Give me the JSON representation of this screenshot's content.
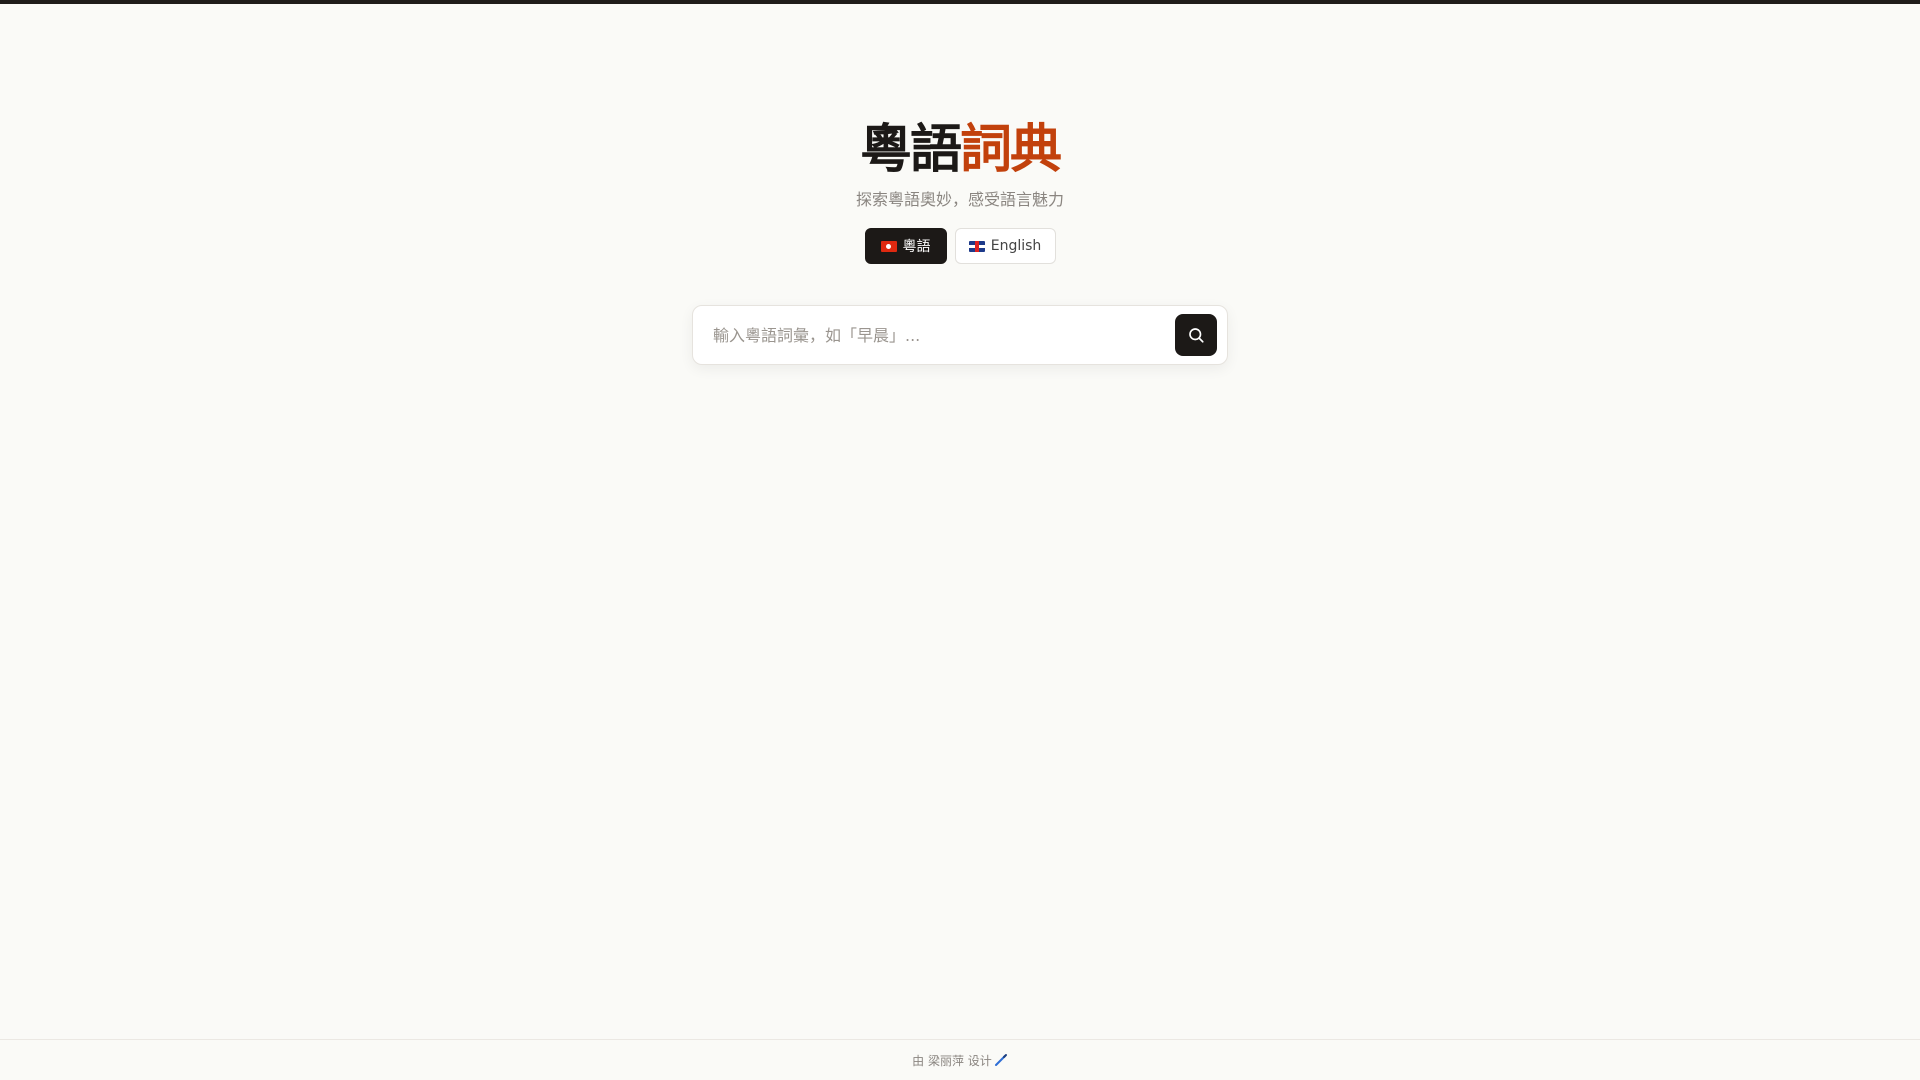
{
  "header": {
    "title_part1": "粵語",
    "title_part2": "詞典",
    "subtitle": "探索粵語奧妙，感受語言魅力"
  },
  "language_switch": {
    "options": [
      {
        "label": "粵語",
        "flag": "hong-kong-flag-icon",
        "active": true
      },
      {
        "label": "English",
        "flag": "uk-flag-icon",
        "active": false
      }
    ]
  },
  "search": {
    "placeholder": "輸入粵語詞彙，如「早晨」...",
    "value": "",
    "button_icon": "search-icon"
  },
  "footer": {
    "text": "由 梁丽萍 设计",
    "icon": "pen-icon"
  },
  "colors": {
    "accent": "#c2410c",
    "dark": "#1c1917",
    "background": "#fafaf7"
  }
}
